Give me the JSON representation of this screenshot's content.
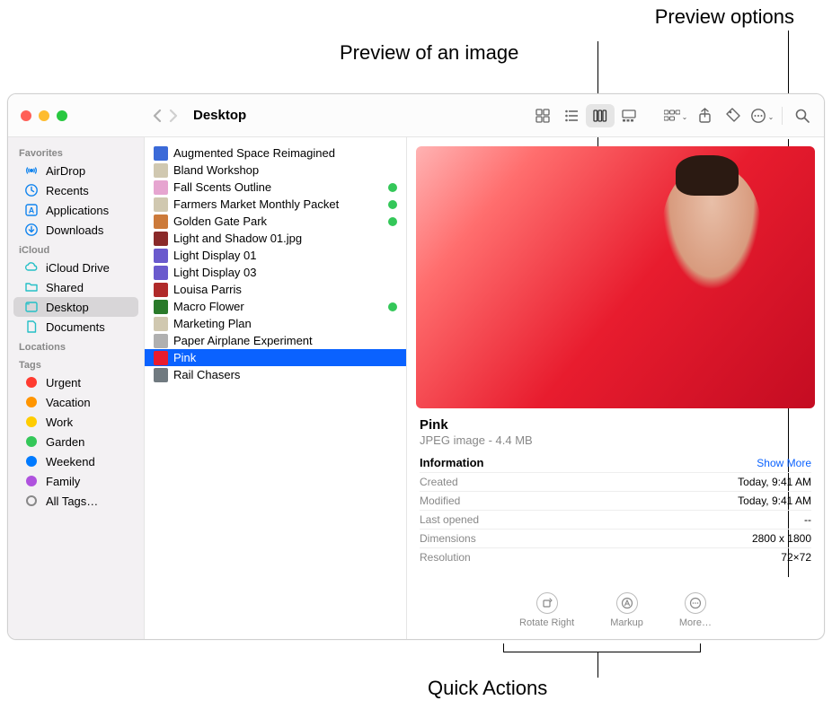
{
  "callouts": {
    "preview_options": "Preview options",
    "preview_image": "Preview of an image",
    "quick_actions": "Quick Actions"
  },
  "window": {
    "title": "Desktop",
    "traffic": {
      "close": "#ff5f57",
      "min": "#febc2e",
      "max": "#28c840"
    }
  },
  "sidebar": {
    "sections": [
      {
        "header": "Favorites",
        "items": [
          {
            "icon": "airdrop",
            "label": "AirDrop"
          },
          {
            "icon": "recents",
            "label": "Recents"
          },
          {
            "icon": "apps",
            "label": "Applications"
          },
          {
            "icon": "downloads",
            "label": "Downloads"
          }
        ]
      },
      {
        "header": "iCloud",
        "items": [
          {
            "icon": "icloud",
            "label": "iCloud Drive"
          },
          {
            "icon": "shared",
            "label": "Shared"
          },
          {
            "icon": "desktop",
            "label": "Desktop",
            "active": true
          },
          {
            "icon": "documents",
            "label": "Documents"
          }
        ]
      },
      {
        "header": "Locations",
        "items": []
      },
      {
        "header": "Tags",
        "items": [
          {
            "icon": "tag",
            "color": "#ff3b30",
            "label": "Urgent"
          },
          {
            "icon": "tag",
            "color": "#ff9500",
            "label": "Vacation"
          },
          {
            "icon": "tag",
            "color": "#ffcc00",
            "label": "Work"
          },
          {
            "icon": "tag",
            "color": "#34c759",
            "label": "Garden"
          },
          {
            "icon": "tag",
            "color": "#007aff",
            "label": "Weekend"
          },
          {
            "icon": "tag",
            "color": "#af52de",
            "label": "Family"
          },
          {
            "icon": "alltags",
            "label": "All Tags…"
          }
        ]
      }
    ]
  },
  "files": [
    {
      "name": "Augmented Space Reimagined",
      "iconColor": "#3b6ad8"
    },
    {
      "name": "Bland Workshop",
      "iconColor": "#d0c8b0"
    },
    {
      "name": "Fall Scents Outline",
      "iconColor": "#e6a5d0",
      "tag": "#34c759"
    },
    {
      "name": "Farmers Market Monthly Packet",
      "iconColor": "#d0c8b0",
      "tag": "#34c759"
    },
    {
      "name": "Golden Gate Park",
      "iconColor": "#cc7a3a",
      "tag": "#34c759"
    },
    {
      "name": "Light and Shadow 01.jpg",
      "iconColor": "#8a2a2a"
    },
    {
      "name": "Light Display 01",
      "iconColor": "#6a5acd"
    },
    {
      "name": "Light Display 03",
      "iconColor": "#6a5acd"
    },
    {
      "name": "Louisa Parris",
      "iconColor": "#b02a2a"
    },
    {
      "name": "Macro Flower",
      "iconColor": "#2a7a2a",
      "tag": "#34c759"
    },
    {
      "name": "Marketing Plan",
      "iconColor": "#d0c8b0"
    },
    {
      "name": "Paper Airplane Experiment",
      "iconColor": "#b0b0b0"
    },
    {
      "name": "Pink",
      "iconColor": "#e81c2e",
      "selected": true
    },
    {
      "name": "Rail Chasers",
      "iconColor": "#707a80"
    }
  ],
  "preview": {
    "name": "Pink",
    "subtitle": "JPEG image - 4.4 MB",
    "info_label": "Information",
    "show_more": "Show More",
    "rows": [
      {
        "k": "Created",
        "v": "Today, 9:41 AM"
      },
      {
        "k": "Modified",
        "v": "Today, 9:41 AM"
      },
      {
        "k": "Last opened",
        "v": "--"
      },
      {
        "k": "Dimensions",
        "v": "2800 x 1800"
      },
      {
        "k": "Resolution",
        "v": "72×72"
      }
    ],
    "actions": [
      {
        "label": "Rotate Right",
        "icon": "rotate"
      },
      {
        "label": "Markup",
        "icon": "markup"
      },
      {
        "label": "More…",
        "icon": "more"
      }
    ]
  }
}
